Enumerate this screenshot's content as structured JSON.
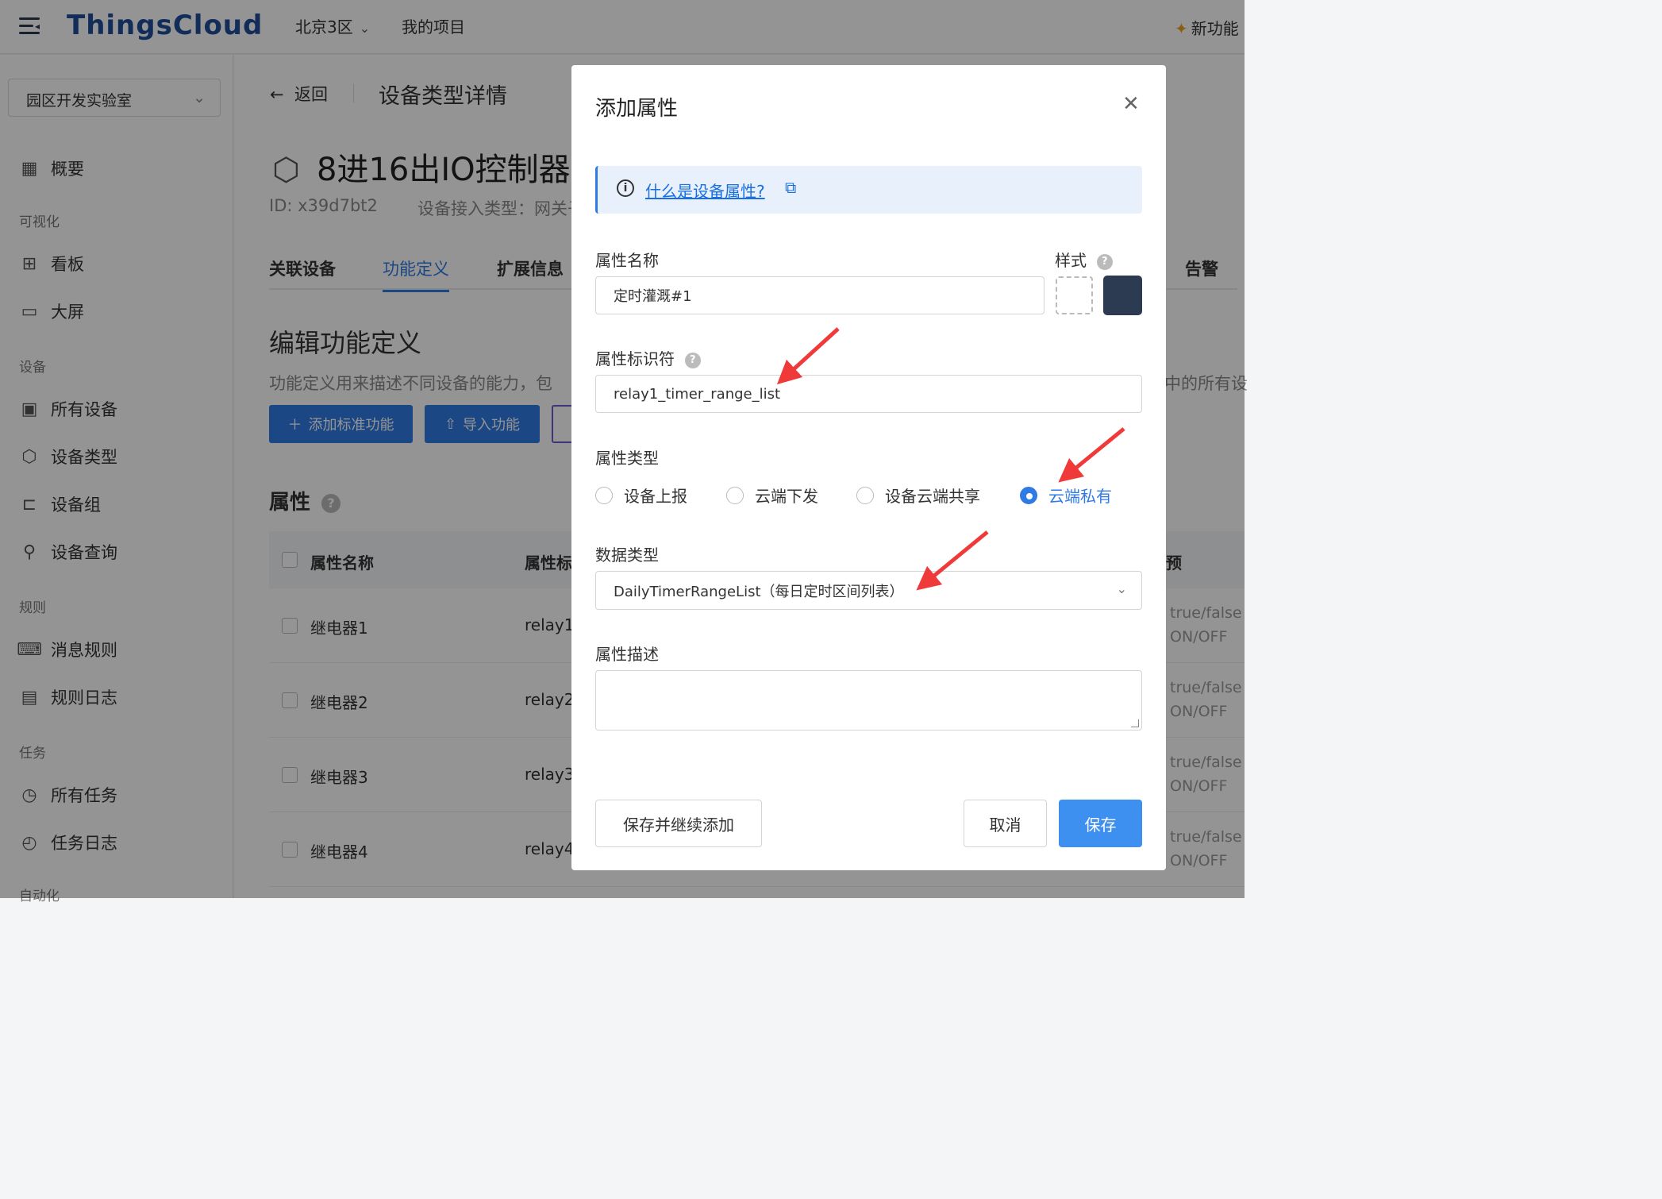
{
  "topbar": {
    "menu_icon": "menu-collapse-icon",
    "logo": "ThingsCloud",
    "region": "北京3区",
    "projects": "我的项目",
    "new_feature": "新功能"
  },
  "sidebar": {
    "org": "园区开发实验室",
    "overview": "概要",
    "groups": {
      "visual": "可视化",
      "device": "设备",
      "rules": "规则",
      "tasks": "任务",
      "auto": "自动化"
    },
    "items": {
      "dashboard": "看板",
      "bigscreen": "大屏",
      "all_devices": "所有设备",
      "device_types": "设备类型",
      "device_groups": "设备组",
      "device_query": "设备查询",
      "message_rules": "消息规则",
      "rule_logs": "规则日志",
      "all_tasks": "所有任务",
      "task_logs": "任务日志"
    }
  },
  "main": {
    "back": "返回",
    "page_title": "设备类型详情",
    "device_name": "8进16出IO控制器",
    "device_id": "ID: x39d7bt2",
    "device_access": "设备接入类型：网关子",
    "tabs": [
      "关联设备",
      "功能定义",
      "扩展信息"
    ],
    "tab_right": "告警",
    "section_title": "编辑功能定义",
    "section_desc": "功能定义用来描述不同设备的能力，包",
    "section_desc_right": "中的所有设",
    "buttons": {
      "add_standard": "添加标准功能",
      "import": "导入功能"
    },
    "properties_title": "属性",
    "table": {
      "headers": [
        "属性名称",
        "属性标",
        "预"
      ],
      "rows": [
        {
          "name": "继电器1",
          "ident": "relay1",
          "v1": "true/false",
          "v2": "ON/OFF"
        },
        {
          "name": "继电器2",
          "ident": "relay2",
          "v1": "true/false",
          "v2": "ON/OFF"
        },
        {
          "name": "继电器3",
          "ident": "relay3",
          "v1": "true/false",
          "v2": "ON/OFF"
        },
        {
          "name": "继电器4",
          "ident": "relay4",
          "v1": "true/false",
          "v2": "ON/OFF"
        }
      ]
    }
  },
  "modal": {
    "title": "添加属性",
    "info_link": "什么是设备属性?",
    "name_label": "属性名称",
    "name_value": "定时灌溉#1",
    "style_label": "样式",
    "style_color": "#2c3a52",
    "ident_label": "属性标识符",
    "ident_value": "relay1_timer_range_list",
    "type_label": "属性类型",
    "type_options": [
      "设备上报",
      "云端下发",
      "设备云端共享",
      "云端私有"
    ],
    "type_selected": "云端私有",
    "data_type_label": "数据类型",
    "data_type_value": "DailyTimerRangeList（每日定时区间列表）",
    "desc_label": "属性描述",
    "desc_value": "",
    "btn_save_continue": "保存并继续添加",
    "btn_cancel": "取消",
    "btn_save": "保存"
  },
  "colors": {
    "primary": "#2f7ae5",
    "logo": "#1f4e99",
    "annotation_arrow": "#f03a3a"
  }
}
